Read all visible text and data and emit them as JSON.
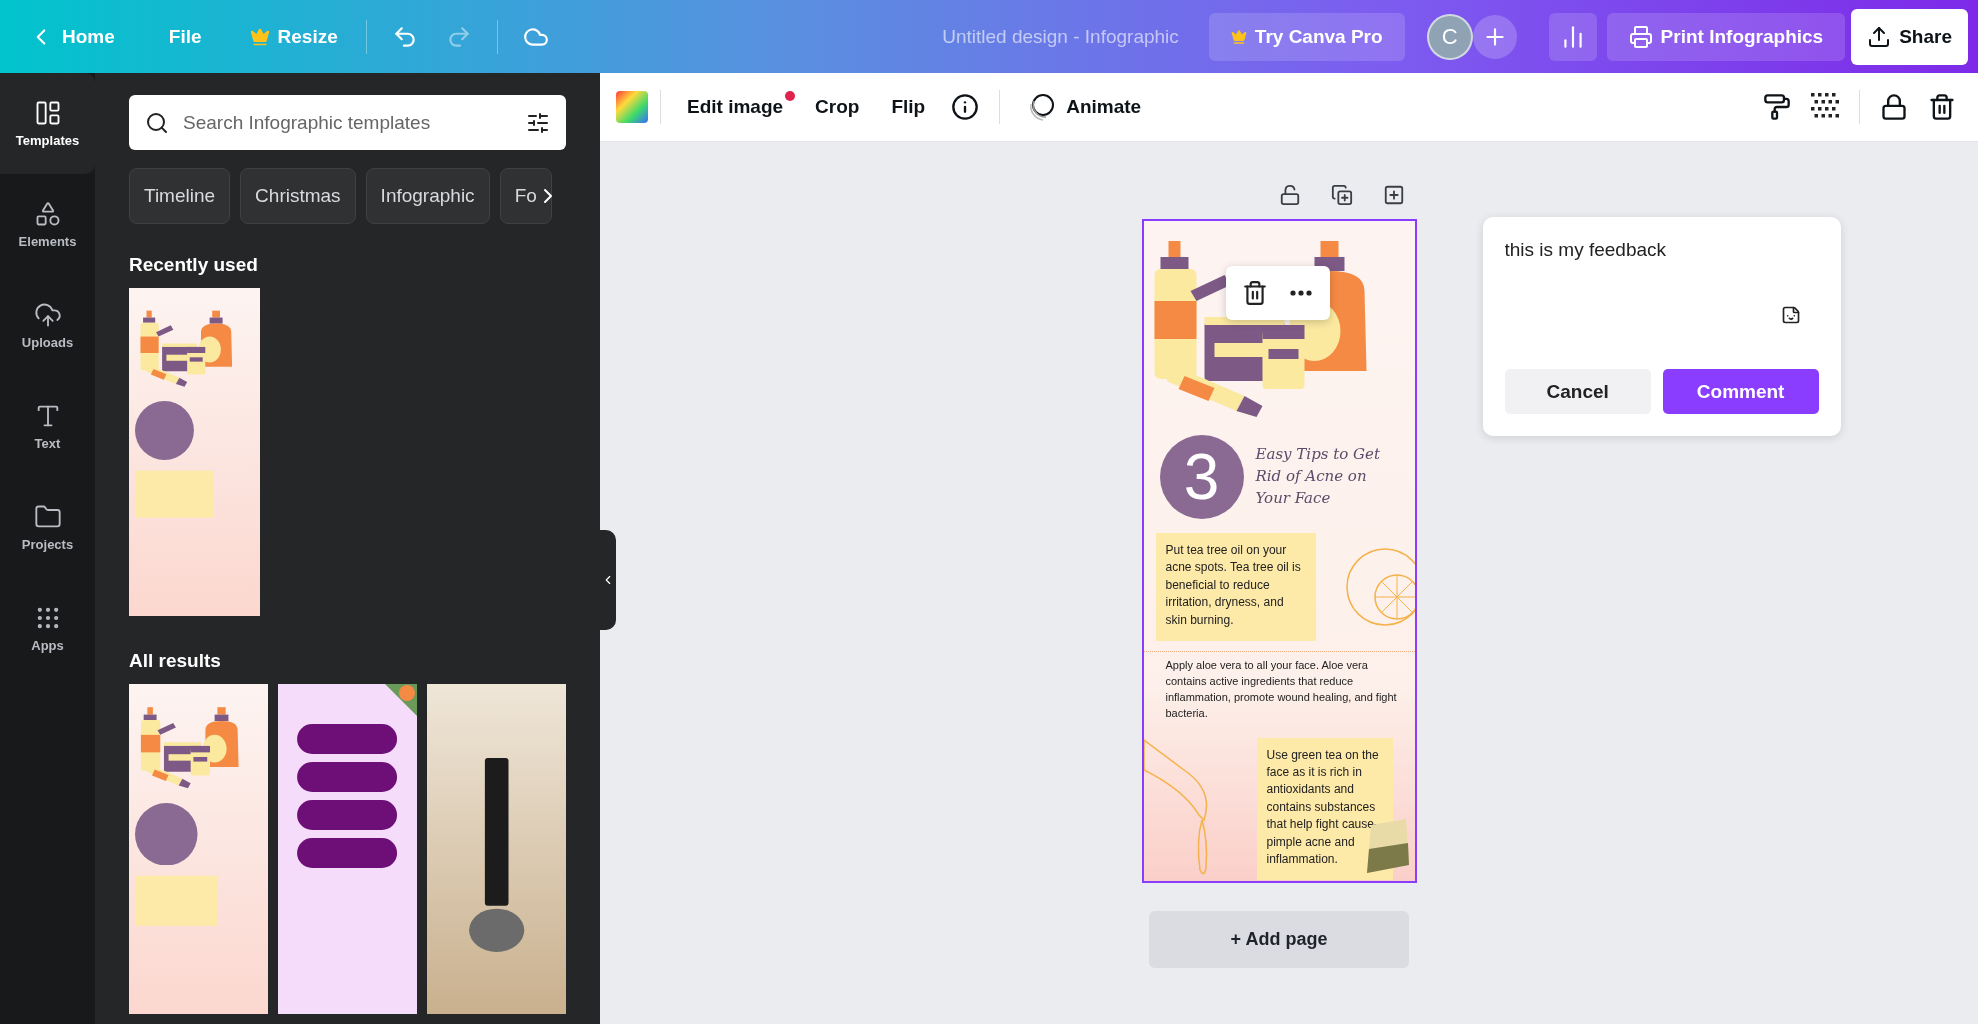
{
  "top_bar": {
    "home": "Home",
    "file": "File",
    "resize": "Resize",
    "undo_disabled": false,
    "redo_disabled": true,
    "title": "Untitled design - Infographic",
    "try_pro": "Try Canva Pro",
    "avatar": "C",
    "print": "Print Infographics",
    "share": "Share"
  },
  "rail": [
    {
      "kind": "templates",
      "label": "Templates",
      "selected": true
    },
    {
      "kind": "elements",
      "label": "Elements",
      "selected": false
    },
    {
      "kind": "uploads",
      "label": "Uploads",
      "selected": false
    },
    {
      "kind": "text",
      "label": "Text",
      "selected": false
    },
    {
      "kind": "projects",
      "label": "Projects",
      "selected": false
    },
    {
      "kind": "apps",
      "label": "Apps",
      "selected": false
    }
  ],
  "panel": {
    "search_placeholder": "Search Infographic templates",
    "chips": [
      "Timeline",
      "Christmas",
      "Infographic",
      "Fo"
    ],
    "recent_heading": "Recently used",
    "recent": [
      {
        "kind": "acne"
      }
    ],
    "results_heading": "All results",
    "results": [
      {
        "kind": "acne"
      },
      {
        "kind": "flower"
      },
      {
        "kind": "routine"
      }
    ]
  },
  "toolbar": {
    "edit_image": "Edit image",
    "edit_image_notification": true,
    "crop": "Crop",
    "flip": "Flip",
    "animate": "Animate"
  },
  "design": {
    "selected": true,
    "number": "3",
    "title": "Easy Tips to Get Rid of Acne on Your Face",
    "tip_1": "Put tea tree oil on your acne spots. Tea tree oil is beneficial to reduce irritation, dryness, and skin burning.",
    "tip_2": "Apply aloe vera to all your face. Aloe vera contains active ingredients that reduce inflammation, promote wound healing, and fight bacteria.",
    "tip_3": "Use green tea on the face as it is rich in antioxidants and contains substances that help fight cause-pimple acne and inflammation."
  },
  "add_page": "+ Add page",
  "comment": {
    "value": "this is my feedback",
    "cancel": "Cancel",
    "submit": "Comment"
  }
}
